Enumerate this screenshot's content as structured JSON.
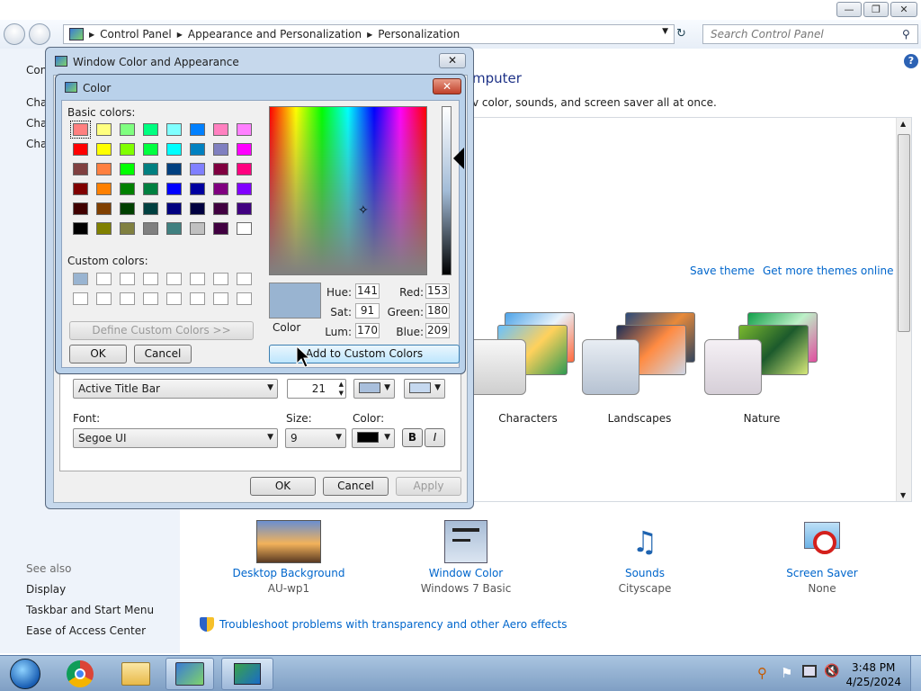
{
  "nav": {
    "breadcrumbs": [
      "Control Panel",
      "Appearance and Personalization",
      "Personalization"
    ],
    "search_placeholder": "Search Control Panel"
  },
  "left_pane": {
    "top_links": [
      "Con",
      "Cha",
      "Cha",
      "Cha"
    ],
    "see_also": "See also",
    "links": [
      "Display",
      "Taskbar and Start Menu",
      "Ease of Access Center"
    ]
  },
  "main": {
    "heading": "mputer",
    "subtitle": "v color, sounds, and screen saver all at once.",
    "save_theme": "Save theme",
    "get_more": "Get more themes online",
    "themes": [
      "Characters",
      "Landscapes",
      "Nature"
    ]
  },
  "bottom": {
    "items": [
      {
        "title": "Desktop Background",
        "sub": "AU-wp1"
      },
      {
        "title": "Window Color",
        "sub": "Windows 7 Basic"
      },
      {
        "title": "Sounds",
        "sub": "Cityscape"
      },
      {
        "title": "Screen Saver",
        "sub": "None"
      }
    ],
    "troubleshoot": "Troubleshoot problems with transparency and other Aero effects"
  },
  "window_color": {
    "title": "Window Color and Appearance",
    "item_value": "Active Title Bar",
    "size_value": "21",
    "font_label": "Font:",
    "font_value": "Segoe UI",
    "size_label": "Size:",
    "font_size_value": "9",
    "color_label": "Color:",
    "bold": "B",
    "italic": "I",
    "ok": "OK",
    "cancel": "Cancel",
    "apply": "Apply",
    "color1": "#a9bfdc",
    "color2": "#c5d8ef"
  },
  "color_dialog": {
    "title": "Color",
    "basic_colors_label": "Basic colors:",
    "custom_colors_label": "Custom colors:",
    "define_custom": "Define Custom Colors >>",
    "ok": "OK",
    "cancel": "Cancel",
    "add_custom": "Add to Custom Colors",
    "color_label": "Color",
    "hue_label": "Hue:",
    "hue": "141",
    "sat_label": "Sat:",
    "sat": "91",
    "lum_label": "Lum:",
    "lum": "170",
    "red_label": "Red:",
    "red": "153",
    "green_label": "Green:",
    "green": "180",
    "blue_label": "Blue:",
    "blue": "209",
    "current_color": "#99b4d1",
    "basic_colors": [
      "#ff8080",
      "#ffff80",
      "#80ff80",
      "#00ff80",
      "#80ffff",
      "#0080ff",
      "#ff80c0",
      "#ff80ff",
      "#ff0000",
      "#ffff00",
      "#80ff00",
      "#00ff40",
      "#00ffff",
      "#0080c0",
      "#8080c0",
      "#ff00ff",
      "#804040",
      "#ff8040",
      "#00ff00",
      "#008080",
      "#004080",
      "#8080ff",
      "#800040",
      "#ff0080",
      "#800000",
      "#ff8000",
      "#008000",
      "#008040",
      "#0000ff",
      "#0000a0",
      "#800080",
      "#8000ff",
      "#400000",
      "#804000",
      "#004000",
      "#004040",
      "#000080",
      "#000040",
      "#400040",
      "#400080",
      "#000000",
      "#808000",
      "#808040",
      "#808080",
      "#408080",
      "#c0c0c0",
      "#400040",
      "#ffffff"
    ],
    "custom_colors": [
      "#99b4d1",
      "#ffffff",
      "#ffffff",
      "#ffffff",
      "#ffffff",
      "#ffffff",
      "#ffffff",
      "#ffffff",
      "#ffffff",
      "#ffffff",
      "#ffffff",
      "#ffffff",
      "#ffffff",
      "#ffffff",
      "#ffffff",
      "#ffffff"
    ]
  },
  "taskbar": {
    "time": "3:48 PM",
    "date": "4/25/2024"
  }
}
